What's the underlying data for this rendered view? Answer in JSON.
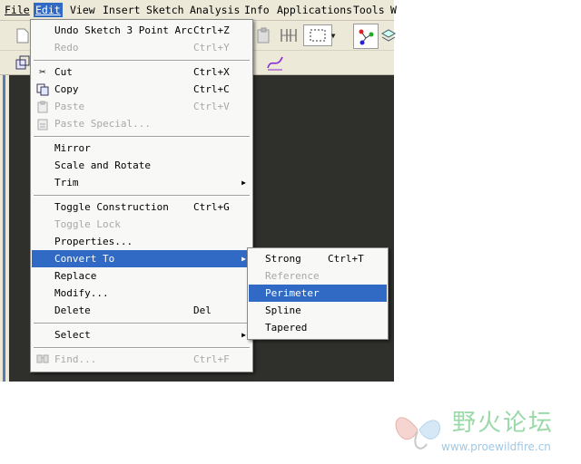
{
  "menubar": {
    "items": [
      {
        "label": "File",
        "m": "F"
      },
      {
        "label": "Edit",
        "m": "E"
      },
      {
        "label": "View",
        "m": "V"
      },
      {
        "label": "Insert",
        "m": "I"
      },
      {
        "label": "Sketch",
        "m": "S"
      },
      {
        "label": "Analysis",
        "m": "A"
      },
      {
        "label": "Info",
        "m": "n"
      },
      {
        "label": "Applications",
        "m": "p"
      },
      {
        "label": "Tools",
        "m": "T"
      },
      {
        "label": "W",
        "m": "W"
      }
    ]
  },
  "edit_menu": {
    "undo": {
      "label": "Undo Sketch 3 Point Arc",
      "shortcut": "Ctrl+Z"
    },
    "redo": {
      "label": "Redo",
      "shortcut": "Ctrl+Y"
    },
    "cut": {
      "label": "Cut",
      "shortcut": "Ctrl+X"
    },
    "copy": {
      "label": "Copy",
      "shortcut": "Ctrl+C"
    },
    "paste": {
      "label": "Paste",
      "shortcut": "Ctrl+V"
    },
    "paste_special": {
      "label": "Paste Special..."
    },
    "mirror": {
      "label": "Mirror"
    },
    "scale_rotate": {
      "label": "Scale and Rotate"
    },
    "trim": {
      "label": "Trim"
    },
    "toggle_construction": {
      "label": "Toggle Construction",
      "shortcut": "Ctrl+G"
    },
    "toggle_lock": {
      "label": "Toggle Lock"
    },
    "properties": {
      "label": "Properties..."
    },
    "convert_to": {
      "label": "Convert To"
    },
    "replace": {
      "label": "Replace"
    },
    "modify": {
      "label": "Modify..."
    },
    "delete": {
      "label": "Delete",
      "shortcut": "Del"
    },
    "select": {
      "label": "Select"
    },
    "find": {
      "label": "Find...",
      "shortcut": "Ctrl+F"
    }
  },
  "convert_submenu": {
    "strong": {
      "label": "Strong",
      "shortcut": "Ctrl+T"
    },
    "reference": {
      "label": "Reference"
    },
    "perimeter": {
      "label": "Perimeter"
    },
    "spline": {
      "label": "Spline"
    },
    "tapered": {
      "label": "Tapered"
    }
  },
  "watermark": {
    "title": "野火论坛",
    "url": "www.proewildfire.cn"
  },
  "colors": {
    "highlight": "#316ac5",
    "menu_bg": "#f8f8f6",
    "graphics_bg": "#2f2f2c",
    "disabled": "#a8a8a8"
  }
}
